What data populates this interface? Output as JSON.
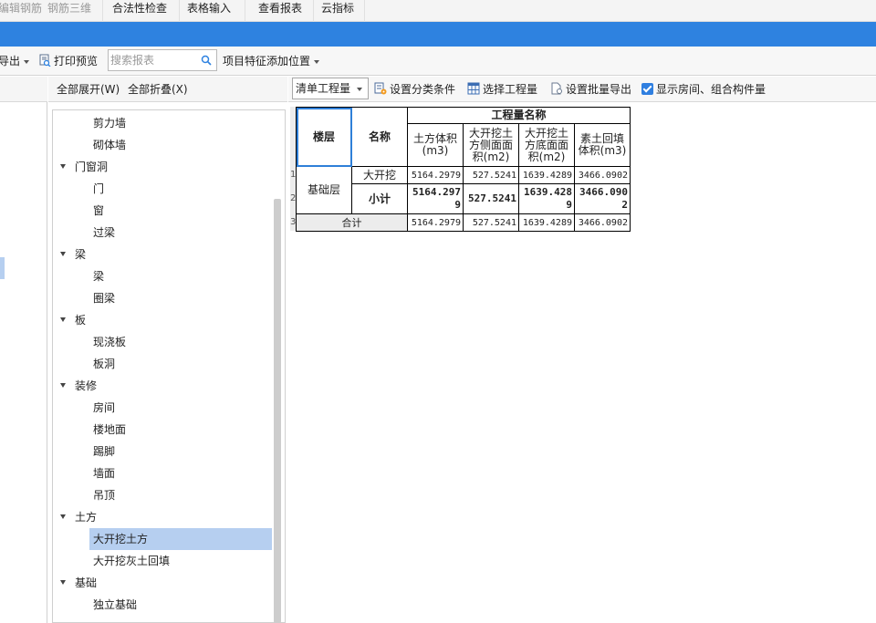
{
  "ribbon": {
    "tabs": [
      {
        "label": "编辑钢筋",
        "disabled": true
      },
      {
        "label": "钢筋三维",
        "disabled": true
      },
      {
        "label": "合法性检查",
        "disabled": false
      },
      {
        "label": "表格输入",
        "disabled": false
      },
      {
        "label": "查看报表",
        "disabled": false
      },
      {
        "label": "云指标",
        "disabled": false
      }
    ]
  },
  "toolbar": {
    "export_label": "导出",
    "print_preview_label": "打印预览",
    "search_placeholder": "搜索报表",
    "feature_position_label": "项目特征添加位置"
  },
  "tree": {
    "expand_all": "全部展开(W)",
    "collapse_all": "全部折叠(X)",
    "nodes": [
      {
        "label": "剪力墙",
        "type": "leaf"
      },
      {
        "label": "砌体墙",
        "type": "leaf"
      },
      {
        "label": "门窗洞",
        "type": "category"
      },
      {
        "label": "门",
        "type": "leaf"
      },
      {
        "label": "窗",
        "type": "leaf"
      },
      {
        "label": "过梁",
        "type": "leaf"
      },
      {
        "label": "梁",
        "type": "category"
      },
      {
        "label": "梁",
        "type": "leaf"
      },
      {
        "label": "圈梁",
        "type": "leaf"
      },
      {
        "label": "板",
        "type": "category"
      },
      {
        "label": "现浇板",
        "type": "leaf"
      },
      {
        "label": "板洞",
        "type": "leaf"
      },
      {
        "label": "装修",
        "type": "category"
      },
      {
        "label": "房间",
        "type": "leaf"
      },
      {
        "label": "楼地面",
        "type": "leaf"
      },
      {
        "label": "踢脚",
        "type": "leaf"
      },
      {
        "label": "墙面",
        "type": "leaf"
      },
      {
        "label": "吊顶",
        "type": "leaf"
      },
      {
        "label": "土方",
        "type": "category"
      },
      {
        "label": "大开挖土方",
        "type": "leaf",
        "selected": true
      },
      {
        "label": "大开挖灰土回填",
        "type": "leaf"
      },
      {
        "label": "基础",
        "type": "category"
      },
      {
        "label": "独立基础",
        "type": "leaf"
      }
    ]
  },
  "report_toolbar": {
    "qty_select_value": "清单工程量",
    "set_category_label": "设置分类条件",
    "select_qty_label": "选择工程量",
    "set_batch_export_label": "设置批量导出",
    "show_rooms_label": "显示房间、组合构件量",
    "show_rooms_checked": true
  },
  "report": {
    "header_floor": "楼层",
    "header_name": "名称",
    "header_group": "工程量名称",
    "columns": [
      "土方体积(m3)",
      "大开挖土方侧面面积(m2)",
      "大开挖土方底面面积(m2)",
      "素土回填体积(m3)"
    ],
    "row_numbers": [
      "1",
      "2",
      "3"
    ],
    "floor": "基础层",
    "rows": [
      {
        "name": "大开挖",
        "values": [
          "5164.2979",
          "527.5241",
          "1639.4289",
          "3466.0902"
        ]
      },
      {
        "name": "小计",
        "values": [
          "5164.2979",
          "527.5241",
          "1639.4289",
          "3466.0902"
        ]
      }
    ],
    "total_label": "合计",
    "total_values": [
      "5164.2979",
      "527.5241",
      "1639.4289",
      "3466.0902"
    ]
  }
}
